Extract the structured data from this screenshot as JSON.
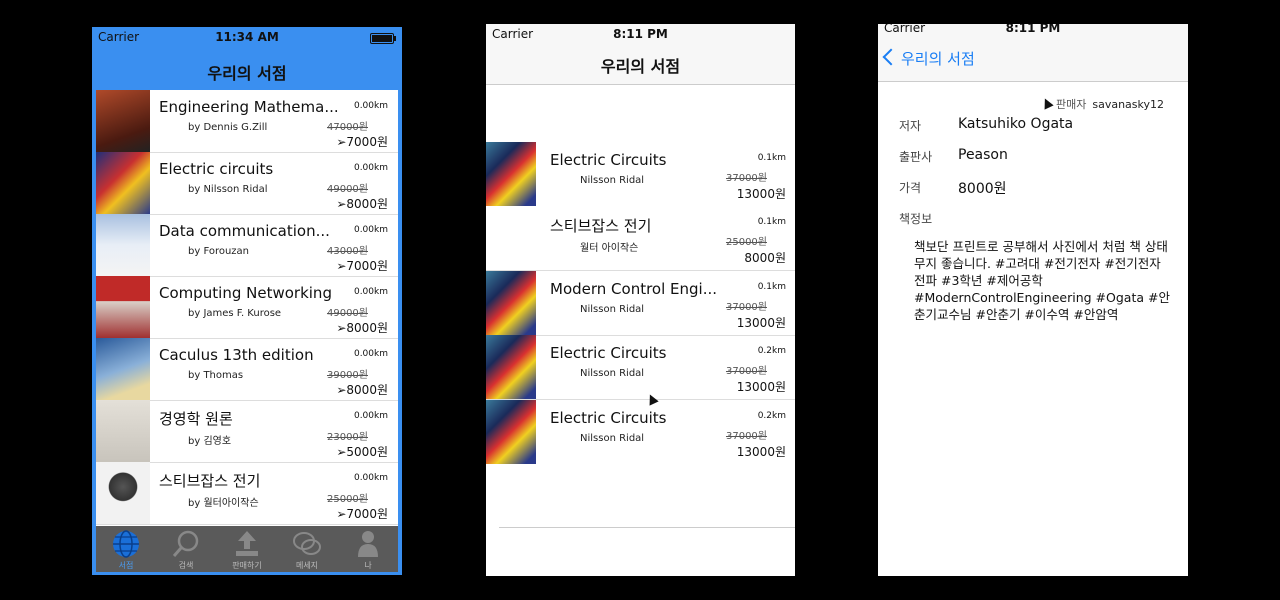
{
  "screen1": {
    "status": {
      "carrier": "Carrier",
      "time": "11:34 AM"
    },
    "title": "우리의 서점",
    "books": [
      {
        "title": "Engineering Mathema...",
        "author": "by Dennis G.Zill",
        "distance": "0.00km",
        "original_price": "47000원",
        "price": "➢7000원",
        "cover_color": "#7a2a1a"
      },
      {
        "title": "Electric circuits",
        "author": "by Nilsson Ridal",
        "distance": "0.00km",
        "original_price": "49000원",
        "price": "➢8000원",
        "cover_color": "#2d3d8a"
      },
      {
        "title": "Data communication...",
        "author": "by Forouzan",
        "distance": "0.00km",
        "original_price": "43000원",
        "price": "➢7000원",
        "cover_color": "#c9d6e8"
      },
      {
        "title": "Computing Networking",
        "author": "by James F. Kurose",
        "distance": "0.00km",
        "original_price": "49000원",
        "price": "➢8000원",
        "cover_color": "#b8302a"
      },
      {
        "title": "Caculus 13th edition",
        "author": "by Thomas",
        "distance": "0.00km",
        "original_price": "39000원",
        "price": "➢8000원",
        "cover_color": "#3a6ea8"
      },
      {
        "title": "경영학 원론",
        "author": "by 김영호",
        "distance": "0.00km",
        "original_price": "23000원",
        "price": "➢5000원",
        "cover_color": "#d8d4cc"
      },
      {
        "title": "스티브잡스 전기",
        "author": "by 월터아이작슨",
        "distance": "0.00km",
        "original_price": "25000원",
        "price": "➢7000원",
        "cover_color": "#e8e8e8"
      }
    ],
    "tabs": [
      {
        "label": "서점",
        "icon": "globe-icon"
      },
      {
        "label": "검색",
        "icon": "search-icon"
      },
      {
        "label": "판매하기",
        "icon": "upload-icon"
      },
      {
        "label": "메세지",
        "icon": "chat-icon"
      },
      {
        "label": "나",
        "icon": "person-icon"
      }
    ],
    "colors": {
      "accent": "#3a8ff0",
      "tabbar": "#5a5a5a",
      "active_tab": "#4a9cf2"
    }
  },
  "screen2": {
    "status": {
      "carrier": "Carrier",
      "time": "8:11 PM"
    },
    "title": "우리의 서점",
    "books": [
      {
        "title": "Electric Circuits",
        "author": "Nilsson Ridal",
        "distance": "0.1km",
        "original_price": "37000원",
        "price": "13000원",
        "has_cover": true
      },
      {
        "title": "스티브잡스 전기",
        "author": "월터 아이작슨",
        "distance": "0.1km",
        "original_price": "25000원",
        "price": "8000원",
        "has_cover": false
      },
      {
        "title": "Modern Control Engi...",
        "author": "Nilsson Ridal",
        "distance": "0.1km",
        "original_price": "37000원",
        "price": "13000원",
        "has_cover": true
      },
      {
        "title": "Electric Circuits",
        "author": "Nilsson Ridal",
        "distance": "0.2km",
        "original_price": "37000원",
        "price": "13000원",
        "has_cover": true
      },
      {
        "title": "Electric Circuits",
        "author": "Nilsson Ridal",
        "distance": "0.2km",
        "original_price": "37000원",
        "price": "13000원",
        "has_cover": true
      }
    ]
  },
  "screen3": {
    "status": {
      "carrier": "Carrier",
      "time": "8:11 PM"
    },
    "back_label": "우리의 서점",
    "seller_label": "판매자",
    "seller": "savanasky12",
    "fields": [
      {
        "label": "저자",
        "value": "Katsuhiko Ogata"
      },
      {
        "label": "출판사",
        "value": "Peason"
      },
      {
        "label": "가격",
        "value": "8000원"
      },
      {
        "label": "책정보",
        "value": ""
      }
    ],
    "description": "책보단 프린트로 공부해서 사진에서 처럼 책 상태 무지 좋습니다. #고려대 #전기전자 #전기전자전파 #3학년 #제어공학 #ModernControlEngineering #Ogata #안춘기교수님 #안춘기 #이수역 #안암역"
  }
}
